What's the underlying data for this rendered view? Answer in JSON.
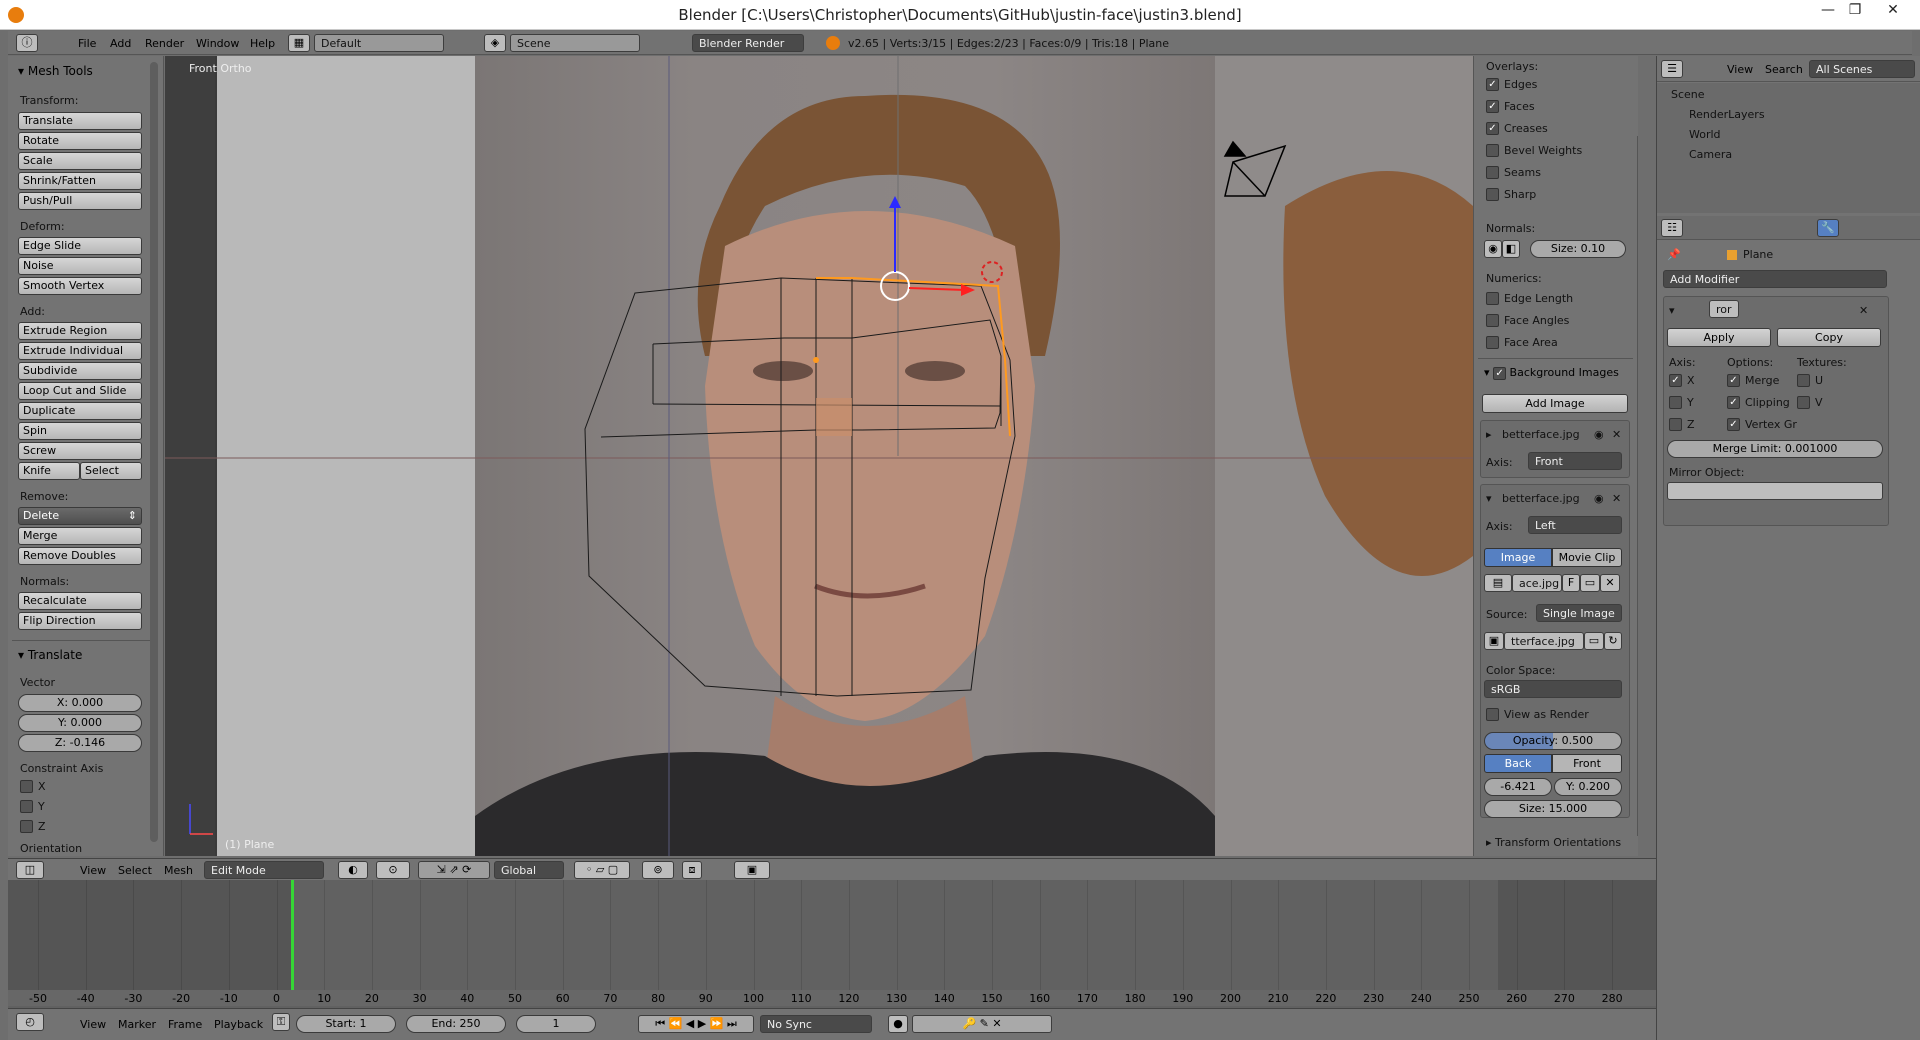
{
  "window": {
    "title": "Blender [C:\\Users\\Christopher\\Documents\\GitHub\\justin-face\\justin3.blend]",
    "minimize": "—",
    "maximize": "❐",
    "close": "✕"
  },
  "infobar": {
    "menus": [
      "File",
      "Add",
      "Render",
      "Window",
      "Help"
    ],
    "layout": "Default",
    "scene": "Scene",
    "engine": "Blender Render",
    "stats": "v2.65 | Verts:3/15 | Edges:2/23 | Faces:0/9 | Tris:18 | Plane"
  },
  "toolshelf": {
    "title": "Mesh Tools",
    "transform_label": "Transform:",
    "transform": [
      "Translate",
      "Rotate",
      "Scale",
      "Shrink/Fatten",
      "Push/Pull"
    ],
    "deform_label": "Deform:",
    "deform": [
      "Edge Slide",
      "Noise",
      "Smooth Vertex"
    ],
    "add_label": "Add:",
    "add": [
      "Extrude Region",
      "Extrude Individual",
      "Subdivide",
      "Loop Cut and Slide",
      "Duplicate",
      "Spin",
      "Screw"
    ],
    "knife": "Knife",
    "select": "Select",
    "remove_label": "Remove:",
    "delete": "Delete",
    "remove": [
      "Merge",
      "Remove Doubles"
    ],
    "normals_label": "Normals:",
    "normals": [
      "Recalculate",
      "Flip Direction"
    ],
    "op_title": "Translate",
    "vector_label": "Vector",
    "x": "X: 0.000",
    "y": "Y: 0.000",
    "z": "Z: -0.146",
    "constraint_label": "Constraint Axis",
    "cx": "X",
    "cy": "Y",
    "cz": "Z",
    "orientation_label": "Orientation"
  },
  "viewport": {
    "view_label": "Front Ortho",
    "object_label": "(1) Plane"
  },
  "npanel": {
    "overlays_label": "Overlays:",
    "overlays": [
      {
        "label": "Edges",
        "checked": true
      },
      {
        "label": "Faces",
        "checked": true
      },
      {
        "label": "Creases",
        "checked": true
      },
      {
        "label": "Bevel Weights",
        "checked": false
      },
      {
        "label": "Seams",
        "checked": false
      },
      {
        "label": "Sharp",
        "checked": false
      }
    ],
    "normals_label": "Normals:",
    "normal_size": "Size: 0.10",
    "numerics_label": "Numerics:",
    "numerics": [
      {
        "label": "Edge Length",
        "checked": false
      },
      {
        "label": "Face Angles",
        "checked": false
      },
      {
        "label": "Face Area",
        "checked": false
      }
    ],
    "bg_title": "Background Images",
    "add_image": "Add Image",
    "img1_name": "betterface.jpg",
    "axis_label": "Axis:",
    "img1_axis": "Front",
    "img2_name": "betterface.jpg",
    "img2_axis": "Left",
    "image_tab": "Image",
    "movieclip_tab": "Movie Clip",
    "img_file": "ace.jpg",
    "img_f": "F",
    "source_label": "Source:",
    "source": "Single Image",
    "file_path": "tterface.jpg",
    "colorspace_label": "Color Space:",
    "colorspace": "sRGB",
    "view_as_render": "View as Render",
    "opacity": "Opacity: 0.500",
    "back": "Back",
    "front": "Front",
    "xoff": "-6.421",
    "yoff": "Y: 0.200",
    "size": "Size: 15.000",
    "transform_orient": "Transform Orientations"
  },
  "outliner": {
    "menus": [
      "View",
      "Search"
    ],
    "filter": "All Scenes",
    "items": [
      "Scene",
      "RenderLayers",
      "World",
      "Camera"
    ]
  },
  "properties": {
    "object": "Plane",
    "add_modifier": "Add Modifier",
    "mod_name": "ror",
    "apply": "Apply",
    "copy": "Copy",
    "axis_label": "Axis:",
    "options_label": "Options:",
    "textures_label": "Textures:",
    "ax": "X",
    "ay": "Y",
    "az": "Z",
    "merge": "Merge",
    "clipping": "Clipping",
    "vertexgr": "Vertex Gr",
    "tu": "U",
    "tv": "V",
    "merge_limit": "Merge Limit: 0.001000",
    "mirror_object": "Mirror Object:"
  },
  "vp_header": {
    "menus": [
      "View",
      "Select",
      "Mesh"
    ],
    "mode": "Edit Mode",
    "orientation": "Global"
  },
  "timeline": {
    "ticks": [
      "-50",
      "-40",
      "-30",
      "-20",
      "-10",
      "0",
      "10",
      "20",
      "30",
      "40",
      "50",
      "60",
      "70",
      "80",
      "90",
      "100",
      "110",
      "120",
      "130",
      "140",
      "150",
      "160",
      "170",
      "180",
      "190",
      "200",
      "210",
      "220",
      "230",
      "240",
      "250",
      "260",
      "270",
      "280"
    ],
    "current_frame": 0
  },
  "tl_header": {
    "menus": [
      "View",
      "Marker",
      "Frame",
      "Playback"
    ],
    "start": "Start: 1",
    "end": "End: 250",
    "frame": "1",
    "sync": "No Sync"
  }
}
